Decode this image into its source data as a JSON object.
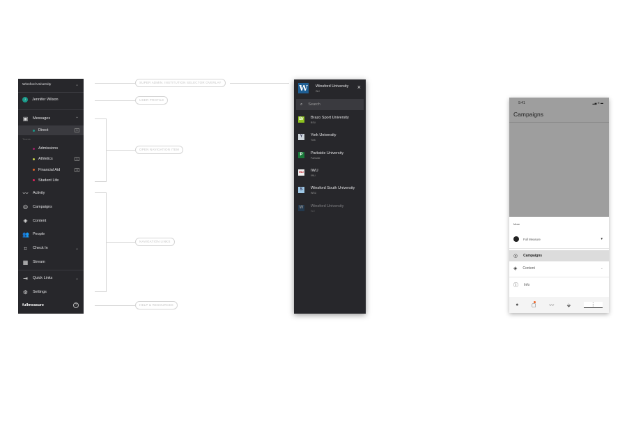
{
  "sidebar": {
    "institution": "Winsford University",
    "user": {
      "name": "Jennifer Wilson",
      "initial": "J"
    },
    "messages": {
      "label": "Messages",
      "direct": "Direct",
      "direct_count": "1",
      "teams_label": "Teams",
      "teams": [
        {
          "label": "Admissions",
          "color": "#a0206a",
          "count": ""
        },
        {
          "label": "Athletics",
          "color": "#c9d64a",
          "count": "1"
        },
        {
          "label": "Financial Aid",
          "color": "#e0662a",
          "count": "3"
        },
        {
          "label": "Student Life",
          "color": "#e0245e",
          "count": ""
        }
      ]
    },
    "nav": [
      "Activity",
      "Campaigns",
      "Content",
      "People",
      "Check In",
      "Stream"
    ],
    "quick_links": "Quick Links",
    "settings": "Settings",
    "brand": "fullmeasure"
  },
  "callouts": {
    "selector": "SUPER ADMIN. INSTITUTION SELECTOR OVERLAY",
    "profile": "USER PROFILE",
    "open_nav": "OPEN NAVIGATION ITEM",
    "nav_links": "NAVIGATION LINKS",
    "help": "HELP & RESOURCES"
  },
  "overlay": {
    "current": {
      "name": "Winsford University",
      "abbr": "WU"
    },
    "search_placeholder": "Search",
    "institutions": [
      {
        "name": "Brazo Sport University",
        "abbr": "BSU",
        "logo": "Br",
        "color": "#8dc21f"
      },
      {
        "name": "York University",
        "abbr": "York",
        "logo": "Y",
        "color": "#cfd6dc"
      },
      {
        "name": "Parkside University",
        "abbr": "Parkside",
        "logo": "P",
        "color": "#1a7a3a"
      },
      {
        "name": "IWU",
        "abbr": "IWU",
        "logo": "IWU",
        "color": "#f2f2f2"
      },
      {
        "name": "Winsford South University",
        "abbr": "WSU",
        "logo": "S",
        "color": "#9fc8e6"
      },
      {
        "name": "Winsford University",
        "abbr": "WU",
        "logo": "W",
        "color": "#1f4f7a"
      }
    ]
  },
  "phone": {
    "time": "9:41",
    "title": "Campaigns",
    "more": "More",
    "account": "Full Measure",
    "menu": [
      "Campaigns",
      "Content",
      "Info"
    ]
  }
}
